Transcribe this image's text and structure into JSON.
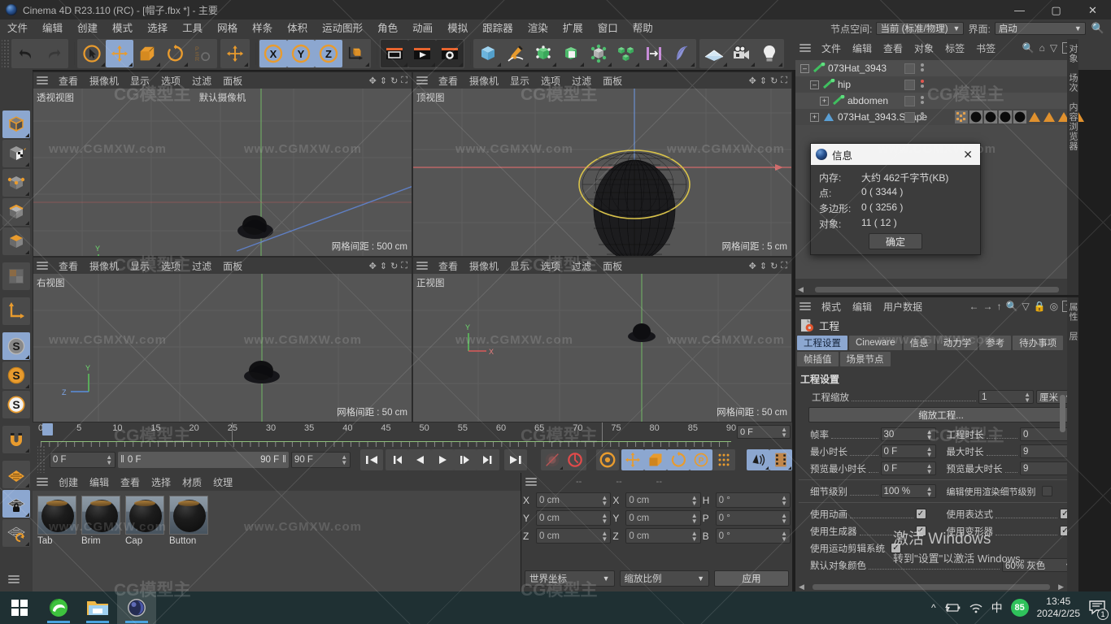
{
  "window": {
    "title": "Cinema 4D R23.110 (RC) - [帽子.fbx *] - 主要",
    "minimize": "—",
    "maximize": "▢",
    "close": "✕"
  },
  "menubar": {
    "items": [
      "文件",
      "编辑",
      "创建",
      "模式",
      "选择",
      "工具",
      "网格",
      "样条",
      "体积",
      "运动图形",
      "角色",
      "动画",
      "模拟",
      "跟踪器",
      "渲染",
      "扩展",
      "窗口",
      "帮助"
    ],
    "node_space_label": "节点空间:",
    "node_space_value": "当前 (标准/物理)",
    "layout_label": "界面:",
    "layout_value": "启动",
    "search_icon": "search-icon"
  },
  "toolbar": {
    "undo": "undo-icon",
    "redo": "redo-icon",
    "select_live": "live-selection-icon",
    "move": "move-icon",
    "scale": "scale-icon",
    "rotate": "rotate-icon",
    "psr": "psr-icon",
    "move_world": "move-world-icon",
    "axis_x": "X",
    "axis_y": "Y",
    "axis_z": "Z",
    "coord_system": "coordinate-system-icon",
    "render_view": "render-view-icon",
    "render_picture": "render-to-picture-icon",
    "render_queue": "render-queue-icon",
    "render_settings": "render-settings-icon",
    "cube": "primitive-cube-icon",
    "spline": "spline-pen-icon",
    "generator": "generator-icon",
    "deformer": "deformer-icon",
    "mograph": "mograph-icon",
    "array": "array-icon",
    "scene": "scene-icon",
    "fields": "fields-icon",
    "ground": "ground-icon",
    "camera": "camera-icon",
    "light": "light-icon"
  },
  "lefttool": {
    "items": [
      {
        "name": "model-mode-icon",
        "selected": true
      },
      {
        "name": "texture-mode-icon",
        "selected": false
      },
      {
        "name": "point-mode-icon",
        "selected": false
      },
      {
        "name": "edge-mode-icon",
        "selected": false
      },
      {
        "name": "polygon-mode-icon",
        "selected": false
      },
      {
        "name": "uv-mode-icon",
        "selected": false
      },
      {
        "name": "axis-mode-icon",
        "selected": false
      },
      {
        "name": "snap-off-icon",
        "selected": true
      },
      {
        "name": "snap-enabled-icon",
        "selected": false
      },
      {
        "name": "snap-settings-icon",
        "selected": false
      },
      {
        "name": "magnet-icon",
        "selected": false
      },
      {
        "name": "workplane-icon",
        "selected": false
      },
      {
        "name": "workplane-lock-icon",
        "selected": true
      },
      {
        "name": "workplane-rotate-icon",
        "selected": false
      }
    ]
  },
  "viewports": {
    "menus": [
      "查看",
      "摄像机",
      "显示",
      "选项",
      "过滤",
      "面板"
    ],
    "panels": [
      {
        "label": "透视视图",
        "camera": "默认摄像机",
        "grid": "网格间距 : 500 cm"
      },
      {
        "label": "顶视图",
        "camera": "",
        "grid": "网格间距 : 5 cm"
      },
      {
        "label": "右视图",
        "camera": "",
        "grid": "网格间距 : 50 cm"
      },
      {
        "label": "正视图",
        "camera": "",
        "grid": "网格间距 : 50 cm"
      }
    ]
  },
  "timeline": {
    "ticks": [
      "0",
      "5",
      "10",
      "15",
      "20",
      "25",
      "30",
      "35",
      "40",
      "45",
      "50",
      "55",
      "60",
      "65",
      "70",
      "75",
      "80",
      "85",
      "90"
    ],
    "current_frame_field": "0 F"
  },
  "transport": {
    "current_frame": "0 F",
    "range_start": "0 F",
    "range_end": "90 F",
    "end_frame": "90 F",
    "buttons": [
      {
        "name": "go-to-start-button",
        "glyph": "start"
      },
      {
        "name": "go-to-prev-key-button",
        "glyph": "prevkey"
      },
      {
        "name": "step-back-button",
        "glyph": "stepback"
      },
      {
        "name": "play-button",
        "glyph": "play"
      },
      {
        "name": "step-forward-button",
        "glyph": "stepfwd"
      },
      {
        "name": "go-to-next-key-button",
        "glyph": "nextkey"
      },
      {
        "name": "go-to-end-button",
        "glyph": "end"
      }
    ],
    "record_button": "record-active-objects-icon",
    "autokey_button": "autokeying-icon",
    "keyframe_settings": "keyframe-settings-icon",
    "key_position": "key-position-icon",
    "key_scale": "key-scale-icon",
    "key_rotation": "key-rotation-icon",
    "key_param": "key-parameter-icon",
    "key_points": "key-point-level-icon",
    "sound_button": "sound-icon",
    "frames_button": "frames-icon"
  },
  "material_manager": {
    "menus": [
      "创建",
      "编辑",
      "查看",
      "选择",
      "材质",
      "纹理"
    ],
    "materials": [
      {
        "name": "Tab"
      },
      {
        "name": "Brim"
      },
      {
        "name": "Cap"
      },
      {
        "name": "Button"
      }
    ]
  },
  "coordinates": {
    "header": [
      "--",
      "--",
      "--"
    ],
    "rows": [
      {
        "label1": "X",
        "v1": "0 cm",
        "label2": "X",
        "v2": "0 cm",
        "label3": "H",
        "v3": "0 °"
      },
      {
        "label1": "Y",
        "v1": "0 cm",
        "label2": "Y",
        "v2": "0 cm",
        "label3": "P",
        "v3": "0 °"
      },
      {
        "label1": "Z",
        "v1": "0 cm",
        "label2": "Z",
        "v2": "0 cm",
        "label3": "B",
        "v3": "0 °"
      }
    ],
    "coord_system": "世界坐标",
    "scale_mode": "缩放比例",
    "apply": "应用"
  },
  "object_manager": {
    "menus": [
      "文件",
      "编辑",
      "查看",
      "对象",
      "标签",
      "书签"
    ],
    "rows": [
      {
        "name": "073Hat_3943",
        "indent": 0,
        "icon": "joint-icon",
        "tags": []
      },
      {
        "name": "hip",
        "indent": 1,
        "icon": "joint-icon",
        "tags": []
      },
      {
        "name": "abdomen",
        "indent": 2,
        "icon": "joint-icon",
        "tags": []
      },
      {
        "name": "073Hat_3943.Shape",
        "indent": 1,
        "icon": "polygon-object-icon",
        "tags": [
          "weight-tag",
          "material-tag",
          "material-tag",
          "material-tag",
          "material-tag",
          "selection-tag",
          "selection-tag",
          "selection-tag",
          "selection-tag"
        ]
      }
    ],
    "side_tabs": [
      "对象",
      "场次",
      "内容浏览器"
    ]
  },
  "attribute_manager": {
    "menus": [
      "模式",
      "编辑",
      "用户数据"
    ],
    "object_title": "工程",
    "tabs": [
      {
        "label": "工程设置",
        "selected": true
      },
      {
        "label": "Cineware",
        "selected": false
      },
      {
        "label": "信息",
        "selected": false
      },
      {
        "label": "动力学",
        "selected": false
      },
      {
        "label": "参考",
        "selected": false
      },
      {
        "label": "待办事项",
        "selected": false
      },
      {
        "label": "帧插值",
        "selected": false
      },
      {
        "label": "场景节点",
        "selected": false
      }
    ],
    "section_title": "工程设置",
    "project_scale_label": "工程缩放",
    "project_scale_value": "1",
    "project_scale_unit": "厘米",
    "scale_project_button": "缩放工程...",
    "rows": [
      {
        "l1": "帧率",
        "v1": "30",
        "l2": "工程时长",
        "v2": "0"
      },
      {
        "l1": "最小时长",
        "v1": "0 F",
        "l2": "最大时长",
        "v2": "9"
      },
      {
        "l1": "预览最小时长",
        "v1": "0 F",
        "l2": "预览最大时长",
        "v2": "9"
      }
    ],
    "lod_label": "细节级别",
    "lod_value": "100 %",
    "lod_render_label": "编辑使用渲染细节级别",
    "checks": [
      {
        "l1": "使用动画",
        "c1": true,
        "l2": "使用表达式",
        "c2": true
      },
      {
        "l1": "使用生成器",
        "c1": true,
        "l2": "使用变形器",
        "c2": true
      },
      {
        "l1": "使用运动剪辑系统",
        "c1": true,
        "l2": "",
        "c2": null
      }
    ],
    "last_label": "默认对象颜色",
    "last_value": "60% 灰色",
    "side_tabs": [
      "属性",
      "层"
    ]
  },
  "info_dialog": {
    "title": "信息",
    "close": "✕",
    "rows": [
      {
        "key": "内存:",
        "value": "大约 462千字节(KB)"
      },
      {
        "key": "点:",
        "value": "0 ( 3344 )"
      },
      {
        "key": "多边形:",
        "value": "0 ( 3256 )"
      },
      {
        "key": "对象:",
        "value": "11 ( 12 )"
      }
    ],
    "ok": "确定"
  },
  "watermark": {
    "small": "www.CGMXW.com",
    "big": "CG模型主"
  },
  "windows_activation": {
    "line1": "激活 Windows",
    "line2": "转到\"设置\"以激活 Windows。"
  },
  "taskbar": {
    "start": "start-icon",
    "apps": [
      "edge-icon",
      "file-explorer-icon",
      "cinema4d-icon"
    ],
    "tray": {
      "chevron": "^",
      "battery": "battery-icon",
      "wifi": "wifi-icon",
      "ime": "中",
      "badge": "85",
      "time": "13:45",
      "date": "2024/2/25",
      "notification": "notification-icon",
      "notif_count": "1"
    }
  }
}
